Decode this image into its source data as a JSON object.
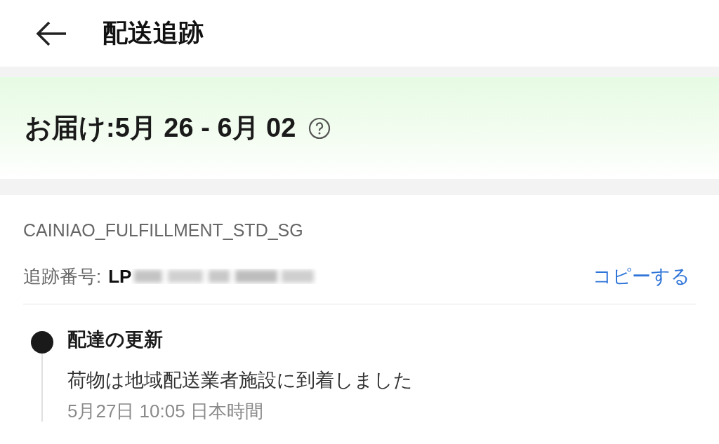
{
  "header": {
    "title": "配送追跡"
  },
  "delivery": {
    "label": "お届け:5月 26 - 6月 02"
  },
  "tracking": {
    "carrier": "CAINIAO_FULFILLMENT_STD_SG",
    "number_label": "追跡番号:",
    "number": "LP",
    "copy_link": "コピーする"
  },
  "timeline": [
    {
      "title": "配達の更新",
      "description": "荷物は地域配送業者施設に到着しました",
      "time": "5月27日 10:05 日本時間",
      "current": true
    }
  ]
}
